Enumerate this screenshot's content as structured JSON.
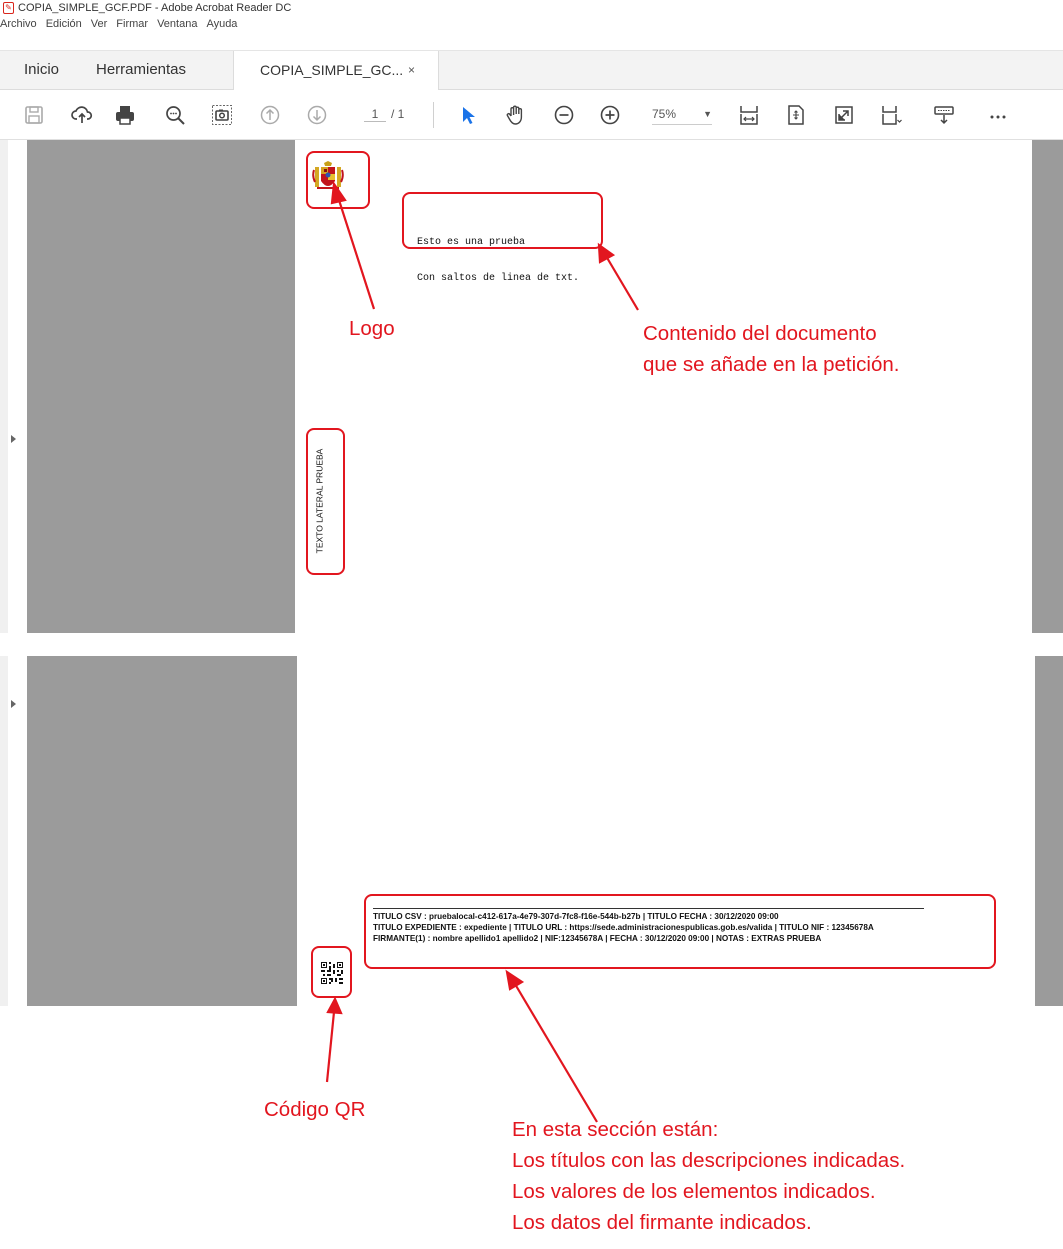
{
  "window": {
    "title": "COPIA_SIMPLE_GCF.PDF - Adobe Acrobat Reader DC",
    "icon": "pdf-app-icon"
  },
  "menu": [
    "Archivo",
    "Edición",
    "Ver",
    "Firmar",
    "Ventana",
    "Ayuda"
  ],
  "tabs": {
    "home": "Inicio",
    "tools": "Herramientas",
    "document": "COPIA_SIMPLE_GC...",
    "close": "×"
  },
  "toolbar": {
    "icons": [
      "save-icon",
      "upload-cloud-icon",
      "print-icon",
      "search-zoom-icon",
      "snapshot-icon",
      "prev-page-icon",
      "next-page-icon",
      "select-arrow-icon",
      "hand-tool-icon",
      "zoom-out-icon",
      "zoom-in-icon",
      "fit-width-icon",
      "fit-page-icon",
      "full-screen-icon",
      "page-display-icon",
      "read-mode-icon",
      "more-icon"
    ],
    "page_current": "1",
    "page_total": "/ 1",
    "zoom": "75%"
  },
  "document": {
    "body_lines": [
      "Esto es una prueba",
      "Con saltos de linea de txt."
    ],
    "side_text": "TEXTO LATERAL PRUEBA",
    "footer_lines": [
      "TITULO CSV : pruebalocal-c412-617a-4e79-307d-7fc8-f16e-544b-b27b | TITULO FECHA : 30/12/2020 09:00",
      "TITULO EXPEDIENTE : expediente | TITULO URL : https://sede.administracionespublicas.gob.es/valida | TITULO NIF : 12345678A",
      "FIRMANTE(1) : nombre apellido1 apellido2 | NIF:12345678A | FECHA : 30/12/2020 09:00 | NOTAS : EXTRAS PRUEBA"
    ]
  },
  "annotations": {
    "logo": "Logo",
    "content": [
      "Contenido del documento",
      "que se añade en la petición."
    ],
    "qr": "Código QR",
    "section": [
      "En esta sección están:",
      "Los títulos con las descripciones indicadas.",
      "Los valores de los elementos indicados.",
      "Los datos del firmante indicados."
    ]
  },
  "colors": {
    "annotation": "#e2161f",
    "app_red": "#d9261c"
  }
}
